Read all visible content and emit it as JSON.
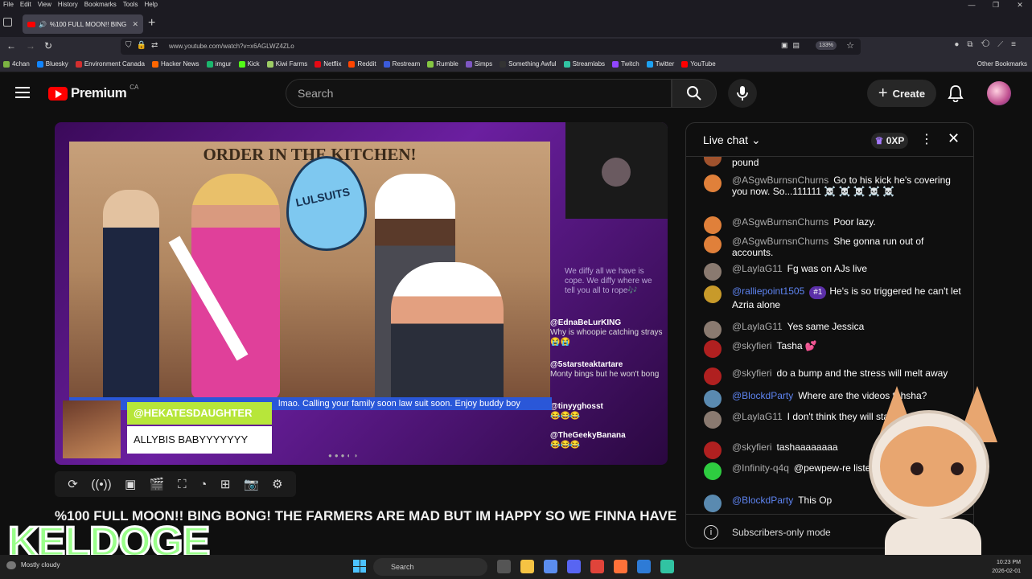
{
  "browser": {
    "menu": [
      "File",
      "Edit",
      "View",
      "History",
      "Bookmarks",
      "Tools",
      "Help"
    ],
    "tab_title": "%100 FULL MOON!! BING B",
    "url": "www.youtube.com/watch?v=x6AGLWZ4ZLo",
    "zoom": "133%",
    "bookmarks": [
      {
        "label": "4chan",
        "color": "#7cb342"
      },
      {
        "label": "Bluesky",
        "color": "#1185fe"
      },
      {
        "label": "Environment Canada",
        "color": "#d32f2f"
      },
      {
        "label": "Hacker News",
        "color": "#ff6600"
      },
      {
        "label": "imgur",
        "color": "#1bb76e"
      },
      {
        "label": "Kick",
        "color": "#53fc18"
      },
      {
        "label": "Kiwi Farms",
        "color": "#9ccc65"
      },
      {
        "label": "Netflix",
        "color": "#e50914"
      },
      {
        "label": "Reddit",
        "color": "#ff4500"
      },
      {
        "label": "Restream",
        "color": "#3b5bdb"
      },
      {
        "label": "Rumble",
        "color": "#85c742"
      },
      {
        "label": "Simps",
        "color": "#7e57c2"
      },
      {
        "label": "Something Awful",
        "color": "#333333"
      },
      {
        "label": "Streamlabs",
        "color": "#31c3a2"
      },
      {
        "label": "Twitch",
        "color": "#9146ff"
      },
      {
        "label": "Twitter",
        "color": "#1da1f2"
      },
      {
        "label": "YouTube",
        "color": "#ff0000"
      }
    ],
    "other_bookmarks": "Other Bookmarks"
  },
  "youtube": {
    "brand": "Premium",
    "country": "CA",
    "search_placeholder": "Search",
    "create_label": "Create"
  },
  "video": {
    "scene_title": "ORDER IN THE KITCHEN!",
    "drop_label": "LULSUITS",
    "overlay_text": "We diffy all we have is cope. We diffy where we tell you all to rope🎶",
    "ticker": "lmao. Calling your family soon law suit soon. Enjoy buddy boy",
    "nameplate_name": "@HEKATESDAUGHTER",
    "nameplate_sub": "ALLYBIS BABYYYYYYY",
    "overlay_msgs": [
      {
        "handle": "@EdnaBeLurKING",
        "text": "Why is whoopie catching strays 😭😭"
      },
      {
        "handle": "@5starsteaktartare",
        "text": "Monty bings but he won't bong"
      },
      {
        "handle": "@tinyyghosst",
        "text": "😂😂😂"
      },
      {
        "handle": "@TheGeekyBanana",
        "text": "😂😂😂"
      }
    ],
    "title": "%100 FULL MOON!! BING BONG! THE FARMERS ARE MAD BUT IM HAPPY SO WE FINNA HAVE"
  },
  "chat": {
    "header": "Live chat",
    "xp": "0XP",
    "footer": "Subscribers-only mode",
    "messages": [
      {
        "author": "",
        "text": "pound",
        "avatar": "#a0522d"
      },
      {
        "author": "@ASgwBurnsnChurns",
        "text": "Go to his kick he's covering you now. So...111111 ☠️ ☠️ ☠️ ☠️ ☠️",
        "avatar": "#e0803a"
      },
      {
        "author": "@ASgwBurnsnChurns",
        "text": "Poor lazy.",
        "avatar": "#e0803a"
      },
      {
        "author": "@ASgwBurnsnChurns",
        "text": "She gonna run out of accounts.",
        "avatar": "#e0803a"
      },
      {
        "author": "@LaylaG11",
        "text": "Fg was on AJs live",
        "avatar": "#8a7a70"
      },
      {
        "author": "@ralliepoint1505",
        "badge": "#1",
        "text": "He's is so triggered he can't let Azria alone",
        "avatar": "#c89a2a"
      },
      {
        "author": "@LaylaG11",
        "text": "Yes same Jessica",
        "avatar": "#8a7a70"
      },
      {
        "author": "@skyfieri",
        "text": "Tasha 💕",
        "avatar": "#b02020"
      },
      {
        "author": "@skyfieri",
        "text": "do a bump and the stress will melt away",
        "avatar": "#b02020"
      },
      {
        "author": "@BlockdParty",
        "text": "Where are the videos tahsha?",
        "avatar": "#5a8ab0"
      },
      {
        "author": "@LaylaG11",
        "text": "I don't think they will stay long",
        "avatar": "#8a7a70"
      },
      {
        "author": "@skyfieri",
        "text": "tashaaaaaaaa",
        "avatar": "#b02020"
      },
      {
        "author": "@Infinity-q4q",
        "text": "@pewpew-re listen. Lol",
        "avatar": "#2ecc40"
      },
      {
        "author": "@BlockdParty",
        "text": "This Op",
        "avatar": "#5a8ab0"
      }
    ]
  },
  "watermark": "KELDOGE",
  "taskbar": {
    "weather": "Mostly cloudy",
    "search": "Search",
    "time": "10:23 PM",
    "date": "2026-02-01"
  }
}
